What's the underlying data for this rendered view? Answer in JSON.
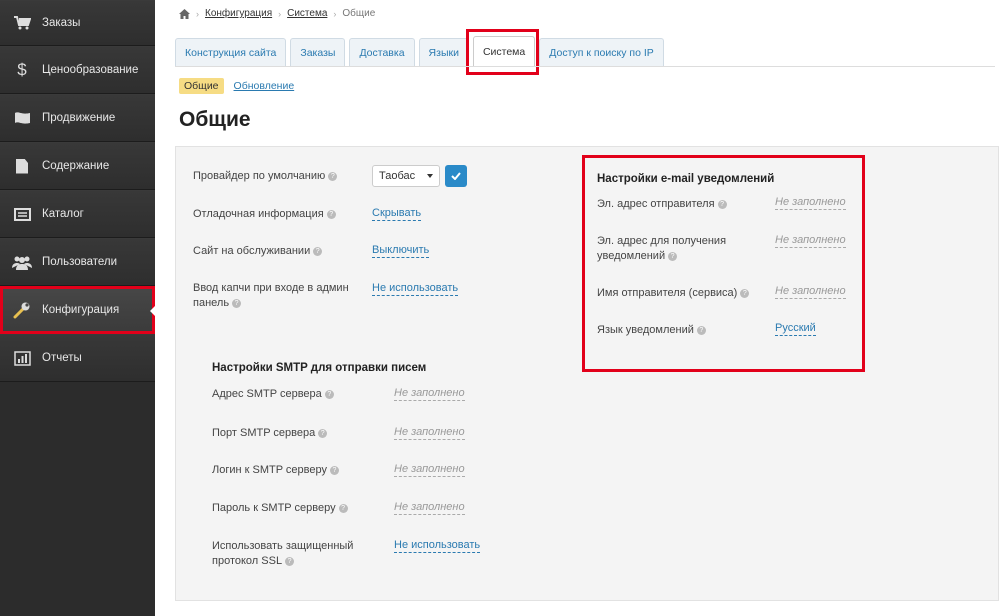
{
  "sidebar": {
    "items": [
      {
        "label": "Заказы"
      },
      {
        "label": "Ценообразование"
      },
      {
        "label": "Продвижение"
      },
      {
        "label": "Содержание"
      },
      {
        "label": "Каталог"
      },
      {
        "label": "Пользователи"
      },
      {
        "label": "Конфигурация"
      },
      {
        "label": "Отчеты"
      }
    ]
  },
  "breadcrumb": {
    "items": [
      "Конфигурация",
      "Система",
      "Общие"
    ]
  },
  "tabs": [
    "Конструкция сайта",
    "Заказы",
    "Доставка",
    "Языки",
    "Система",
    "Доступ к поиску по IP"
  ],
  "subtabs": {
    "active": "Общие",
    "link": "Обновление"
  },
  "page": {
    "title": "Общие"
  },
  "general": {
    "provider_label": "Провайдер по умолчанию",
    "provider_value": "Таобас",
    "debug_label": "Отладочная информация",
    "debug_value": "Скрывать",
    "maintenance_label": "Сайт на обслуживании",
    "maintenance_value": "Выключить",
    "captcha_label": "Ввод капчи при входе в админ панель",
    "captcha_value": "Не использовать"
  },
  "smtp": {
    "title": "Настройки SMTP для отправки писем",
    "address_label": "Адрес SMTP сервера",
    "address_value": "Не заполнено",
    "port_label": "Порт SMTP сервера",
    "port_value": "Не заполнено",
    "login_label": "Логин к SMTP серверу",
    "login_value": "Не заполнено",
    "password_label": "Пароль к SMTP серверу",
    "password_value": "Не заполнено",
    "ssl_label": "Использовать защищенный протокол SSL",
    "ssl_value": "Не использовать"
  },
  "email": {
    "title": "Настройки e-mail уведомлений",
    "sender_label": "Эл. адрес отправителя",
    "sender_value": "Не заполнено",
    "receiver_label": "Эл. адрес для получения уведомлений",
    "receiver_value": "Не заполнено",
    "sender_name_label": "Имя отправителя (сервиса)",
    "sender_name_value": "Не заполнено",
    "language_label": "Язык уведомлений",
    "language_value": "Русский"
  },
  "colors": {
    "accent": "#2a7ab0",
    "highlight": "#e2001a",
    "sidebar": "#2c2c2c",
    "subtab_active": "#f6dc84"
  }
}
